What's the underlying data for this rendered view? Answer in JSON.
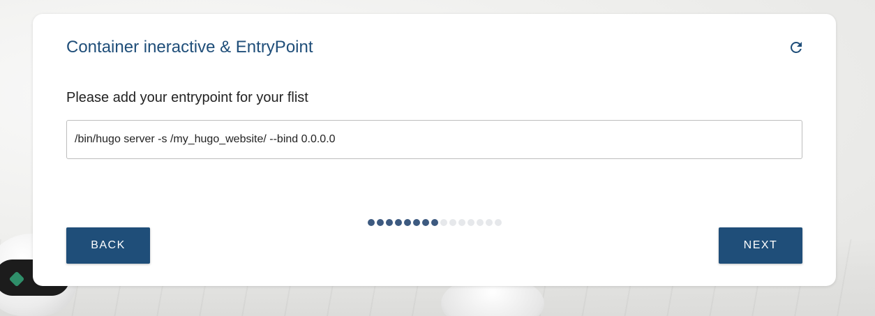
{
  "card": {
    "title": "Container ineractive & EntryPoint",
    "refresh_icon": "refresh-icon",
    "prompt": "Please add your entrypoint for your flist",
    "entrypoint_value": "/bin/hugo server -s /my_hugo_website/ --bind 0.0.0.0"
  },
  "stepper": {
    "total_steps": 15,
    "completed_steps": 8,
    "active_color": "#3d5a80",
    "inactive_color": "#e6e8eb"
  },
  "buttons": {
    "back_label": "BACK",
    "next_label": "NEXT"
  },
  "colors": {
    "primary": "#1f4e79",
    "title": "#1f4e79"
  }
}
